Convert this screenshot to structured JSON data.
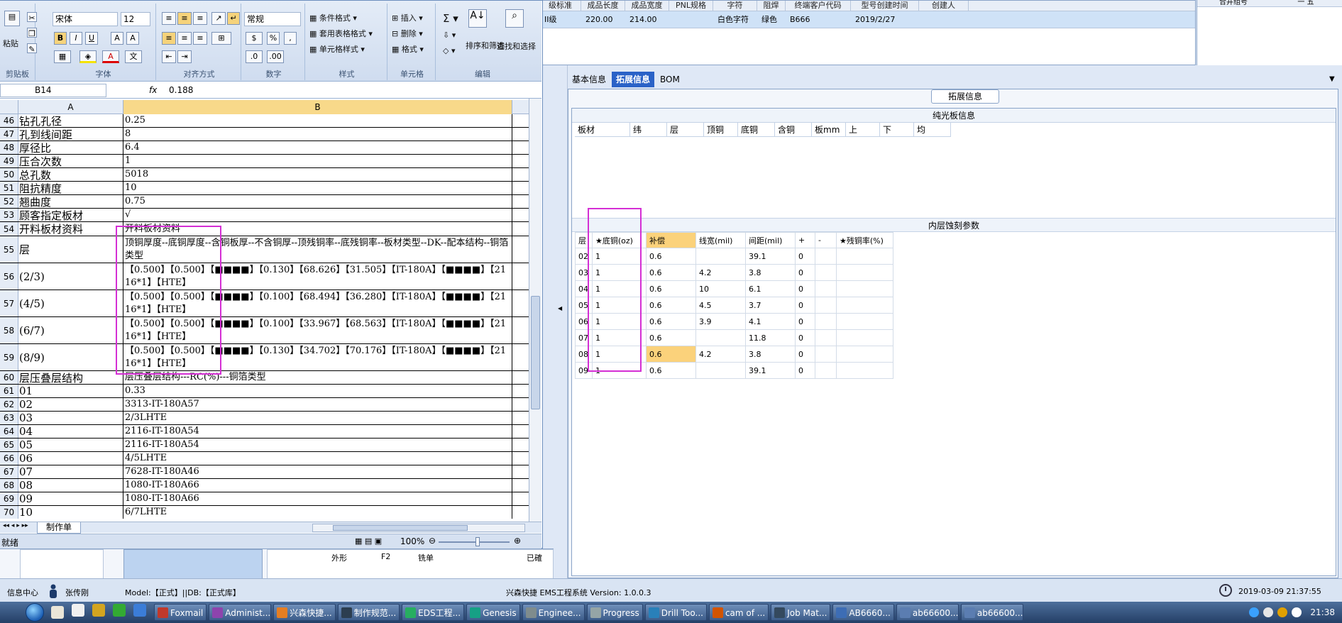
{
  "eds": {
    "top_grid_headers": [
      "级标准",
      "成品长度",
      "成品宽度",
      "PNL规格",
      "字符",
      "阻焊",
      "终端客户代码",
      "型号创建时间",
      "创建人"
    ],
    "top_grid_row": [
      "II级",
      "220.00",
      "214.00",
      "",
      "白色字符",
      "绿色",
      "B666",
      "2019/2/27",
      ""
    ],
    "right_panel_headers": [
      "合并组号",
      "一 五"
    ],
    "tabs": [
      "基本信息",
      "拓展信息",
      "BOM"
    ],
    "active_tab": "拓展信息",
    "ext_label": "拓展信息",
    "section1_title": "纯光板信息",
    "plain_headers": [
      "板材",
      "纬",
      "层",
      "顶铜",
      "底铜",
      "含铜",
      "板mm",
      "上",
      "下",
      "均"
    ],
    "section2_title": "内层蚀刻参数",
    "inner_headers": [
      "层",
      "★底铜(oz)",
      "补偿",
      "线宽(mil)",
      "间距(mil)",
      "+",
      "-",
      "★残铜率(%)"
    ],
    "inner_rows": [
      {
        "layer": "02",
        "cu": "1",
        "comp": "0.6",
        "width": "",
        "space": "39.1",
        "plus": "0",
        "minus": "",
        "res": ""
      },
      {
        "layer": "03",
        "cu": "1",
        "comp": "0.6",
        "width": "4.2",
        "space": "3.8",
        "plus": "0",
        "minus": "",
        "res": ""
      },
      {
        "layer": "04",
        "cu": "1",
        "comp": "0.6",
        "width": "10",
        "space": "6.1",
        "plus": "0",
        "minus": "",
        "res": ""
      },
      {
        "layer": "05",
        "cu": "1",
        "comp": "0.6",
        "width": "4.5",
        "space": "3.7",
        "plus": "0",
        "minus": "",
        "res": ""
      },
      {
        "layer": "06",
        "cu": "1",
        "comp": "0.6",
        "width": "3.9",
        "space": "4.1",
        "plus": "0",
        "minus": "",
        "res": ""
      },
      {
        "layer": "07",
        "cu": "1",
        "comp": "0.6",
        "width": "",
        "space": "11.8",
        "plus": "0",
        "minus": "",
        "res": ""
      },
      {
        "layer": "08",
        "cu": "1",
        "comp": "0.6",
        "width": "4.2",
        "space": "3.8",
        "plus": "0",
        "minus": "",
        "res": ""
      },
      {
        "layer": "09",
        "cu": "1",
        "comp": "0.6",
        "width": "",
        "space": "39.1",
        "plus": "0",
        "minus": "",
        "res": ""
      }
    ],
    "lower_list": [
      "外形",
      "F2",
      "铣单",
      "已確"
    ],
    "status_left": "信息中心",
    "user": "张传刚",
    "model": "Model:【正式】||DB:【正式库】",
    "system": "兴森快捷 EMS工程系统 Version: 1.0.0.3",
    "datetime": "2019-03-09 21:37:55"
  },
  "excel": {
    "ribbon": {
      "paste": "粘贴",
      "clipboard": "剪贴板",
      "font_name": "宋体",
      "font_size": "12",
      "font": "字体",
      "alignment": "对齐方式",
      "number_format": "常规",
      "number": "数字",
      "cond_format": "条件格式",
      "table_format": "套用表格格式",
      "cell_style": "单元格样式",
      "styles": "样式",
      "insert": "插入",
      "delete": "删除",
      "format": "格式",
      "cells": "单元格",
      "sort_filter": "排序和筛选",
      "find_select": "查找和选择",
      "editing": "编辑"
    },
    "namebox": "B14",
    "formula_value": "0.188",
    "col_a": "A",
    "col_b": "B",
    "rows": [
      {
        "n": "46",
        "a": "钻孔孔径",
        "b": "0.25"
      },
      {
        "n": "47",
        "a": "孔到线间距",
        "b": "8"
      },
      {
        "n": "48",
        "a": "厚径比",
        "b": "6.4"
      },
      {
        "n": "49",
        "a": "压合次数",
        "b": "1"
      },
      {
        "n": "50",
        "a": "总孔数",
        "b": "5018"
      },
      {
        "n": "51",
        "a": "阻抗精度",
        "b": "10"
      },
      {
        "n": "52",
        "a": "翘曲度",
        "b": "0.75"
      },
      {
        "n": "53",
        "a": "顾客指定板材",
        "b": "√"
      },
      {
        "n": "54",
        "a": "开料板材资料",
        "b": "开料板材资料"
      },
      {
        "n": "55",
        "a": "层",
        "b": "顶铜厚度--底铜厚度--含铜板厚--不含铜厚--顶残铜率--底残铜率--板材类型--DK--配本结构--铜箔类型"
      },
      {
        "n": "56",
        "a": "(2/3)",
        "b": "【0.500】【0.500】【■■■■】【0.130】【68.626】【31.505】【IT-180A】【■■■■】【2116*1】【HTE】"
      },
      {
        "n": "57",
        "a": "(4/5)",
        "b": "【0.500】【0.500】【■■■■】【0.100】【68.494】【36.280】【IT-180A】【■■■■】【2116*1】【HTE】"
      },
      {
        "n": "58",
        "a": "(6/7)",
        "b": "【0.500】【0.500】【■■■■】【0.100】【33.967】【68.563】【IT-180A】【■■■■】【2116*1】【HTE】"
      },
      {
        "n": "59",
        "a": "(8/9)",
        "b": "【0.500】【0.500】【■■■■】【0.130】【34.702】【70.176】【IT-180A】【■■■■】【2116*1】【HTE】"
      },
      {
        "n": "60",
        "a": "层压叠层结构",
        "b": "层压叠层结构---RC(%)---铜箔类型"
      },
      {
        "n": "61",
        "a": "01",
        "b": "0.33"
      },
      {
        "n": "62",
        "a": "02",
        "b": "3313-IT-180A57"
      },
      {
        "n": "63",
        "a": "03",
        "b": "2/3LHTE"
      },
      {
        "n": "64",
        "a": "04",
        "b": "2116-IT-180A54"
      },
      {
        "n": "65",
        "a": "05",
        "b": "2116-IT-180A54"
      },
      {
        "n": "66",
        "a": "06",
        "b": "4/5LHTE"
      },
      {
        "n": "67",
        "a": "07",
        "b": "7628-IT-180A46"
      },
      {
        "n": "68",
        "a": "08",
        "b": "1080-IT-180A66"
      },
      {
        "n": "69",
        "a": "09",
        "b": "1080-IT-180A66"
      },
      {
        "n": "70",
        "a": "10",
        "b": "6/7LHTE"
      }
    ],
    "sheet_tab": "制作单",
    "status_ready": "就绪",
    "zoom": "100%"
  },
  "taskbar": {
    "items": [
      "Foxmail",
      "Administ...",
      "兴森快捷...",
      "制作规范...",
      "EDS工程...",
      "Genesis",
      "Enginee...",
      "Progress",
      "Drill Too...",
      "cam of ...",
      "Job Mat...",
      "AB6660...",
      "ab66600...",
      "ab66600..."
    ],
    "clock": "21:38"
  }
}
